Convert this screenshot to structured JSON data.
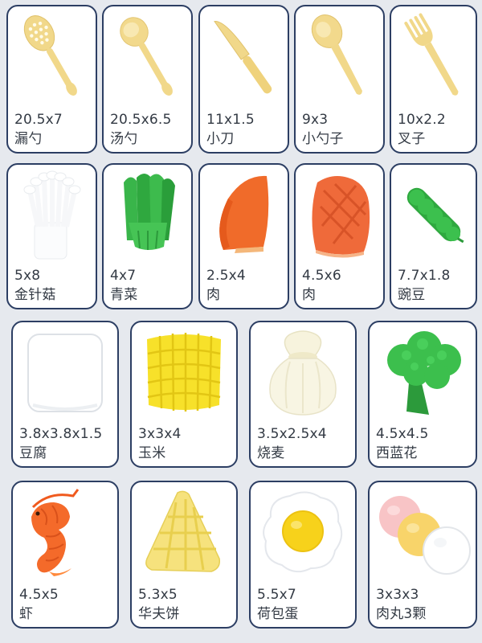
{
  "items": [
    {
      "size": "20.5x7",
      "name": "漏勺",
      "icon": "slotted-spoon-icon"
    },
    {
      "size": "20.5x6.5",
      "name": "汤勺",
      "icon": "soup-ladle-icon"
    },
    {
      "size": "11x1.5",
      "name": "小刀",
      "icon": "knife-icon"
    },
    {
      "size": "9x3",
      "name": "小勺子",
      "icon": "small-spoon-icon"
    },
    {
      "size": "10x2.2",
      "name": "叉子",
      "icon": "fork-icon"
    },
    {
      "size": "5x8",
      "name": "金针菇",
      "icon": "enoki-mushroom-icon"
    },
    {
      "size": "4x7",
      "name": "青菜",
      "icon": "green-vegetable-icon"
    },
    {
      "size": "2.5x4",
      "name": "肉",
      "icon": "meat-slice-icon"
    },
    {
      "size": "4.5x6",
      "name": "肉",
      "icon": "steak-icon"
    },
    {
      "size": "7.7x1.8",
      "name": "豌豆",
      "icon": "pea-pod-icon"
    },
    {
      "size": "3.8x3.8x1.5",
      "name": "豆腐",
      "icon": "tofu-icon"
    },
    {
      "size": "3x3x4",
      "name": "玉米",
      "icon": "corn-icon"
    },
    {
      "size": "3.5x2.5x4",
      "name": "烧麦",
      "icon": "shumai-icon"
    },
    {
      "size": "4.5x4.5",
      "name": "西蓝花",
      "icon": "broccoli-icon"
    },
    {
      "size": "4.5x5",
      "name": "虾",
      "icon": "shrimp-icon"
    },
    {
      "size": "5.3x5",
      "name": "华夫饼",
      "icon": "waffle-icon"
    },
    {
      "size": "5.5x7",
      "name": "荷包蛋",
      "icon": "fried-egg-icon"
    },
    {
      "size": "3x3x3",
      "name": "肉丸3颗",
      "icon": "meatballs-icon"
    }
  ],
  "colors": {
    "border": "#2c3e63",
    "background": "#e6e9ee",
    "utensil": "#f1d88a",
    "text": "#333a44"
  }
}
